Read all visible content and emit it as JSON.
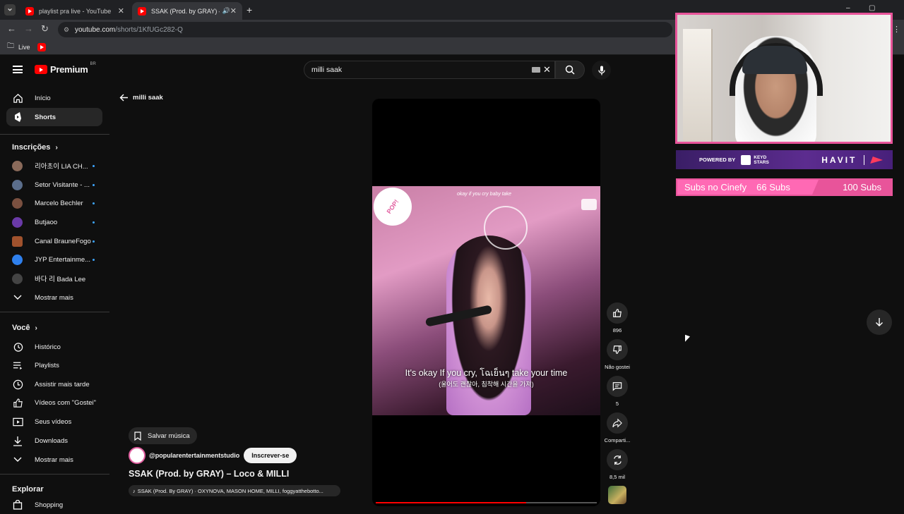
{
  "browser": {
    "tabs": [
      {
        "title": "playlist pra live - YouTube"
      },
      {
        "title": "SSAK (Prod. by GRAY) – Loc"
      }
    ],
    "url_host": "youtube.com",
    "url_path": "/shorts/1KfUGc282-Q",
    "bookmark": "Live"
  },
  "header": {
    "logo": "Premium",
    "region": "BR",
    "search_value": "milli saak"
  },
  "sidebar": {
    "top": [
      {
        "label": "Início",
        "icon": "home-icon"
      },
      {
        "label": "Shorts",
        "icon": "shorts-icon"
      }
    ],
    "subs_title": "Inscrições",
    "subs": [
      {
        "label": "리아초이 LIA CH...",
        "color": "#8a6a5a"
      },
      {
        "label": "Setor Visitante - ...",
        "color": "#5b6e8c"
      },
      {
        "label": "Marcelo Bechler",
        "color": "#7a5040"
      },
      {
        "label": "Butjaoo",
        "color": "#6a3aa8"
      },
      {
        "label": "Canal BrauneFogo",
        "color": "#a0522d"
      },
      {
        "label": "JYP Entertainme...",
        "color": "#2f80ed"
      },
      {
        "label": "바다 리 Bada Lee",
        "color": "#444"
      }
    ],
    "subs_more": "Mostrar mais",
    "you_title": "Você",
    "you": [
      {
        "label": "Histórico",
        "icon": "history-icon"
      },
      {
        "label": "Playlists",
        "icon": "playlists-icon"
      },
      {
        "label": "Assistir mais tarde",
        "icon": "clock-icon"
      },
      {
        "label": "Vídeos com \"Gostei\"",
        "icon": "like-icon"
      },
      {
        "label": "Seus vídeos",
        "icon": "video-icon"
      },
      {
        "label": "Downloads",
        "icon": "download-icon"
      }
    ],
    "you_more": "Mostrar mais",
    "explore_title": "Explorar",
    "explore": [
      {
        "label": "Shopping",
        "icon": "bag-icon"
      }
    ]
  },
  "back_label": "milli saak",
  "short": {
    "save_music": "Salvar música",
    "channel": "@popularentertainmentstudio",
    "subscribe": "Inscrever-se",
    "title": "SSAK (Prod. by GRAY) – Loco & MILLI",
    "music": "SSAK (Prod. By GRAY) · OXYNOVA, MASON HOME, MILLI, foggyatthebotto...",
    "top_caption": "okay if you cry baby take",
    "subtitle_1": "It's okay If you cry, โฉเย็นๆ take your time",
    "subtitle_2": "(울어도 괜찮아, 침착해 시간을 가져)",
    "progress": 0.68
  },
  "actions": {
    "likes": "896",
    "dislike": "Não gostei",
    "comments": "5",
    "share": "Comparti...",
    "remix": "8,5 mil"
  },
  "overlay": {
    "powered": "POWERED BY",
    "brand1": "KEYD STARS",
    "brand2": "HAVIT",
    "subs_label": "Subs no Cinefy",
    "subs_current": "66 Subs",
    "subs_goal": "100 Subs",
    "subs_progress": 0.66
  }
}
